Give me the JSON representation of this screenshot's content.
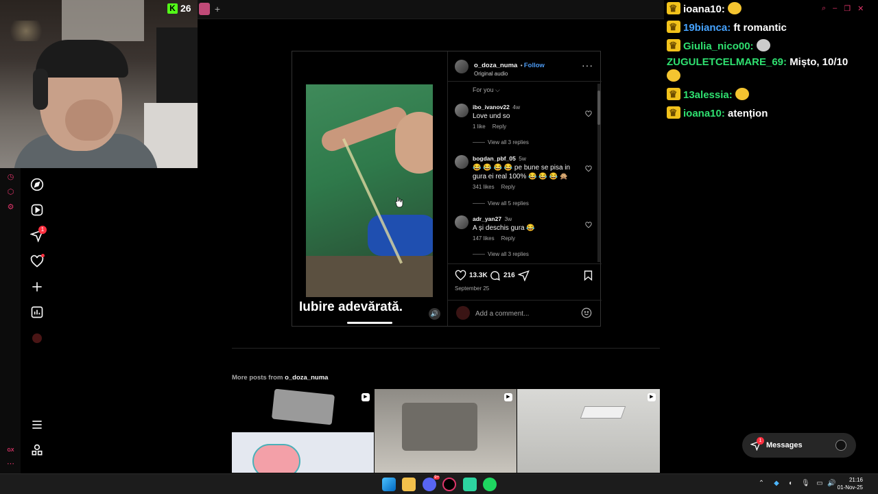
{
  "stream": {
    "viewer_count": "26"
  },
  "post": {
    "username": "o_doza_numa",
    "follow_label": "Follow",
    "audio": "Original audio",
    "caption": "Iubire adevărată.",
    "sort_label": "For you",
    "likes": "13.3K",
    "comment_count": "216",
    "date": "September 25",
    "add_comment_placeholder": "Add a comment..."
  },
  "comments": [
    {
      "user": "ibo_ivanov22",
      "time": "4w",
      "text": "Love und so",
      "likes": "1 like",
      "reply": "Reply",
      "view_replies": "View all 3 replies"
    },
    {
      "user": "bogdan_pbf_05",
      "time": "5w",
      "text": "😂 😂 😂 😂 pe bune se pisa in gura ei real 100% 😂 😂 😂 🙊",
      "likes": "341 likes",
      "reply": "Reply",
      "view_replies": "View all 5 replies"
    },
    {
      "user": "adr_yan27",
      "time": "3w",
      "text": "A și deschis gura 😂",
      "likes": "147 likes",
      "reply": "Reply",
      "view_replies": "View all 3 replies"
    }
  ],
  "more_posts": {
    "prefix": "More posts from",
    "username": "o_doza_numa"
  },
  "chat": [
    {
      "name": "ioana10:",
      "text": "",
      "color": "#ffffff"
    },
    {
      "name": "19bianca:",
      "text": "ft romantic",
      "color": "#46a3ff"
    },
    {
      "name": "Giulia_nico00:",
      "text": "",
      "color": "#2fe070"
    },
    {
      "name": "ZUGULETCELMARE_69:",
      "text": "Mișto, 10/10",
      "color": "#2fe070"
    },
    {
      "name": "13alessia:",
      "text": "",
      "color": "#2fe070"
    },
    {
      "name": "ioana10:",
      "text": "atențion",
      "color": "#2fe070"
    }
  ],
  "messages": {
    "label": "Messages",
    "badge": "1"
  },
  "nav": {
    "notification_count": "1"
  },
  "opera": {
    "gx_label": "GX"
  },
  "taskbar": {
    "time": "21:16",
    "date": "01-Nov-25",
    "discord_badge": "9+"
  },
  "colors": {
    "accent_blue": "#4d9cf5",
    "notification_red": "#ff3040",
    "opera_gx": "#e0356a",
    "kick_green": "#53fc18"
  }
}
